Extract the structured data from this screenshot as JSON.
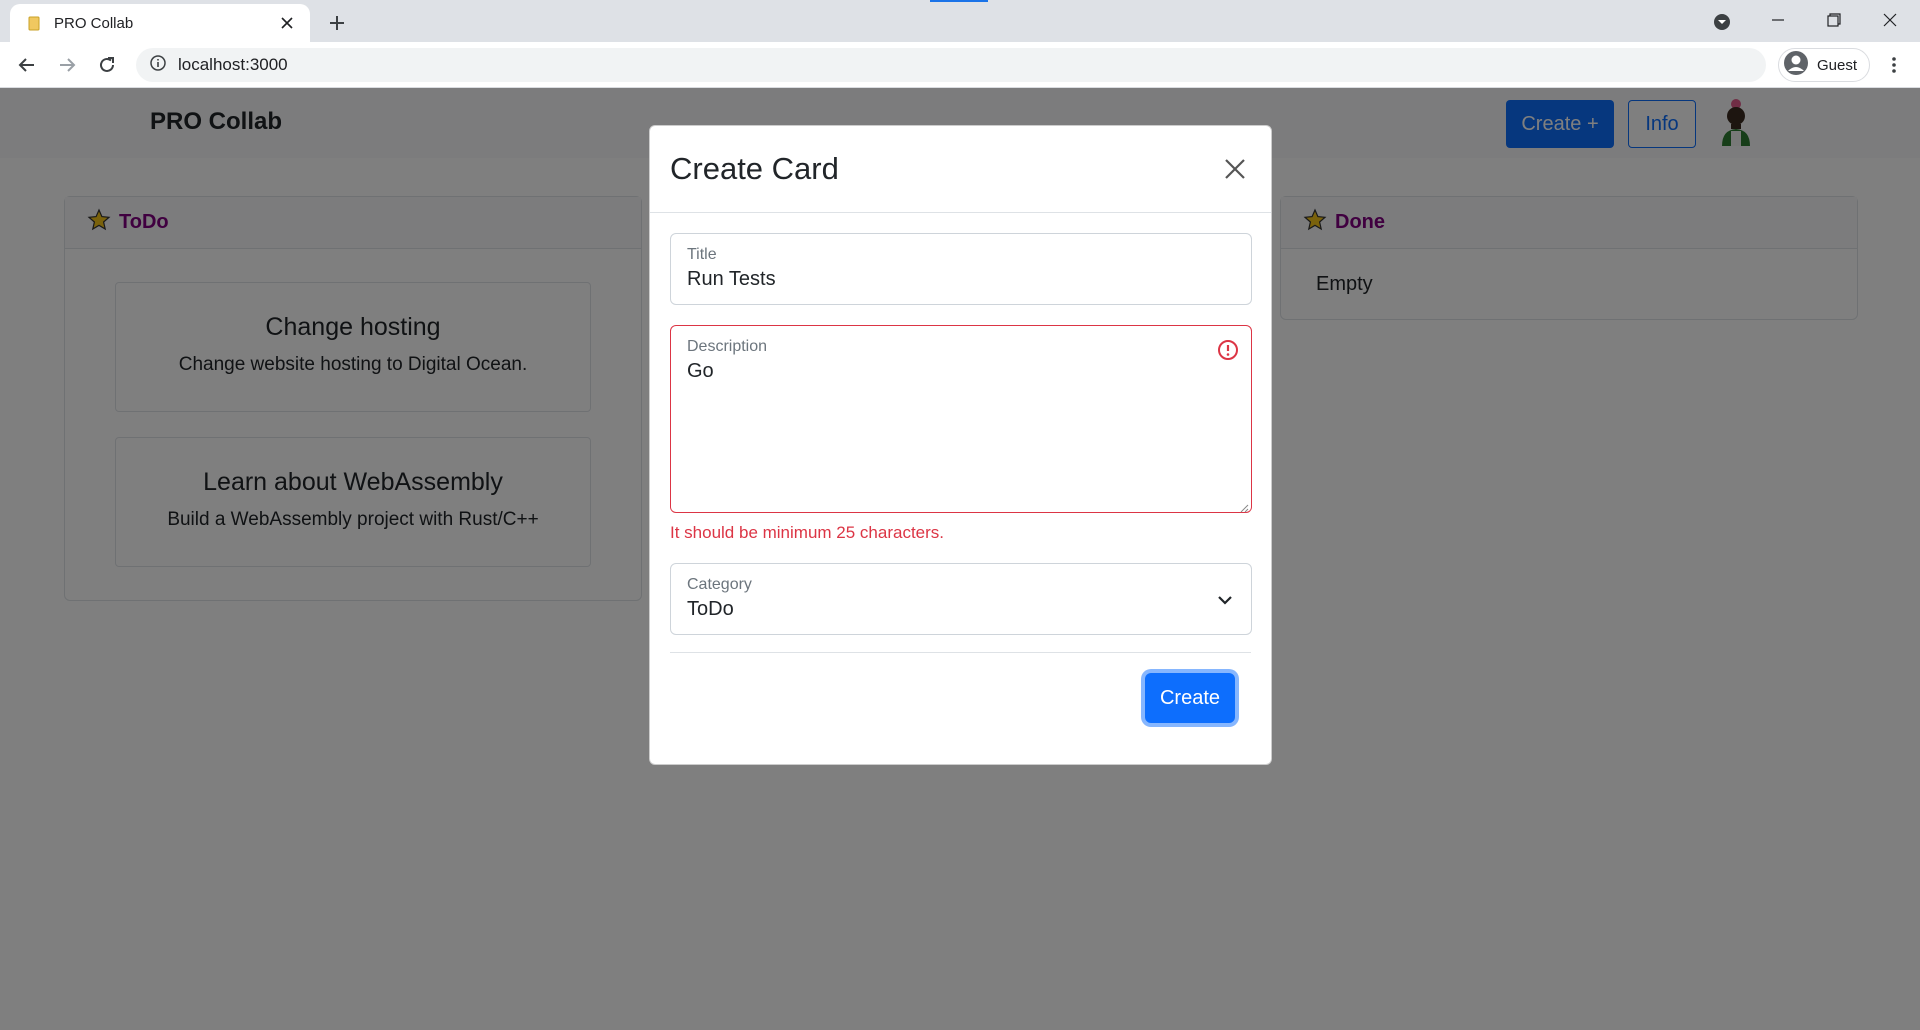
{
  "browser": {
    "tab_title": "PRO Collab",
    "url": "localhost:3000",
    "profile_label": "Guest"
  },
  "app": {
    "brand": "PRO Collab",
    "create_button": "Create +",
    "info_button": "Info"
  },
  "boards": [
    {
      "title": "ToDo",
      "cards": [
        {
          "title": "Change hosting",
          "description": "Change website hosting to Digital Ocean."
        },
        {
          "title": "Learn about WebAssembly",
          "description": "Build a WebAssembly project with Rust/C++"
        }
      ]
    },
    {
      "title": "Done",
      "empty_text": "Empty"
    }
  ],
  "modal": {
    "title": "Create Card",
    "fields": {
      "title": {
        "label": "Title",
        "value": "Run Tests"
      },
      "description": {
        "label": "Description",
        "value": "Go",
        "error": "It should be minimum 25 characters."
      },
      "category": {
        "label": "Category",
        "value": "ToDo"
      }
    },
    "submit_label": "Create"
  },
  "colors": {
    "primary": "#0d6efd",
    "danger": "#dc3545",
    "board_title": "#800080",
    "star": "#f5c518"
  }
}
